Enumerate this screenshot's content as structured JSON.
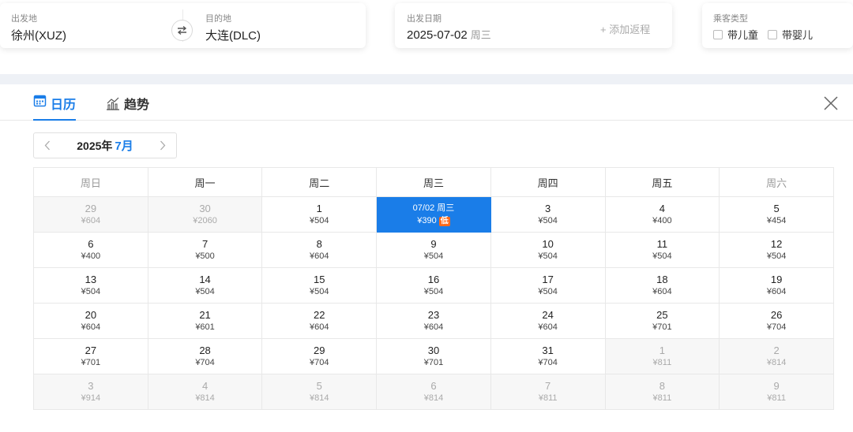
{
  "search": {
    "origin_label": "出发地",
    "origin_value": "徐州(XUZ)",
    "dest_label": "目的地",
    "dest_value": "大连(DLC)",
    "depart_label": "出发日期",
    "depart_date": "2025-07-02",
    "depart_weekday": "周三",
    "add_return": "+ 添加返程",
    "pax_label": "乘客类型",
    "pax_child": "带儿童",
    "pax_infant": "带婴儿"
  },
  "tabs": {
    "calendar": "日历",
    "trend": "趋势"
  },
  "month_nav": {
    "year": "2025年",
    "month": "7月"
  },
  "weekdays": [
    "周日",
    "周一",
    "周二",
    "周三",
    "周四",
    "周五",
    "周六"
  ],
  "calendar_rows": [
    [
      {
        "d": "29",
        "p": "¥604",
        "muted": true
      },
      {
        "d": "30",
        "p": "¥2060",
        "muted": true
      },
      {
        "d": "1",
        "p": "¥504"
      },
      {
        "d": "07/02 周三",
        "p": "¥390",
        "selected": true,
        "badge": "低"
      },
      {
        "d": "3",
        "p": "¥504"
      },
      {
        "d": "4",
        "p": "¥400"
      },
      {
        "d": "5",
        "p": "¥454"
      }
    ],
    [
      {
        "d": "6",
        "p": "¥400"
      },
      {
        "d": "7",
        "p": "¥500"
      },
      {
        "d": "8",
        "p": "¥604"
      },
      {
        "d": "9",
        "p": "¥504"
      },
      {
        "d": "10",
        "p": "¥504"
      },
      {
        "d": "11",
        "p": "¥504"
      },
      {
        "d": "12",
        "p": "¥504"
      }
    ],
    [
      {
        "d": "13",
        "p": "¥504"
      },
      {
        "d": "14",
        "p": "¥504"
      },
      {
        "d": "15",
        "p": "¥504"
      },
      {
        "d": "16",
        "p": "¥504"
      },
      {
        "d": "17",
        "p": "¥504"
      },
      {
        "d": "18",
        "p": "¥604"
      },
      {
        "d": "19",
        "p": "¥604"
      }
    ],
    [
      {
        "d": "20",
        "p": "¥604"
      },
      {
        "d": "21",
        "p": "¥601"
      },
      {
        "d": "22",
        "p": "¥604"
      },
      {
        "d": "23",
        "p": "¥604"
      },
      {
        "d": "24",
        "p": "¥604"
      },
      {
        "d": "25",
        "p": "¥701"
      },
      {
        "d": "26",
        "p": "¥704"
      }
    ],
    [
      {
        "d": "27",
        "p": "¥701"
      },
      {
        "d": "28",
        "p": "¥704"
      },
      {
        "d": "29",
        "p": "¥704"
      },
      {
        "d": "30",
        "p": "¥701"
      },
      {
        "d": "31",
        "p": "¥704"
      },
      {
        "d": "1",
        "p": "¥811",
        "muted": true
      },
      {
        "d": "2",
        "p": "¥814",
        "muted": true
      }
    ],
    [
      {
        "d": "3",
        "p": "¥914",
        "muted": true
      },
      {
        "d": "4",
        "p": "¥814",
        "muted": true
      },
      {
        "d": "5",
        "p": "¥814",
        "muted": true
      },
      {
        "d": "6",
        "p": "¥814",
        "muted": true
      },
      {
        "d": "7",
        "p": "¥811",
        "muted": true
      },
      {
        "d": "8",
        "p": "¥811",
        "muted": true
      },
      {
        "d": "9",
        "p": "¥811",
        "muted": true
      }
    ]
  ],
  "colors": {
    "accent": "#1a7de8",
    "low_badge": "#ff6a1a",
    "muted_bg": "#f7f7f7"
  }
}
